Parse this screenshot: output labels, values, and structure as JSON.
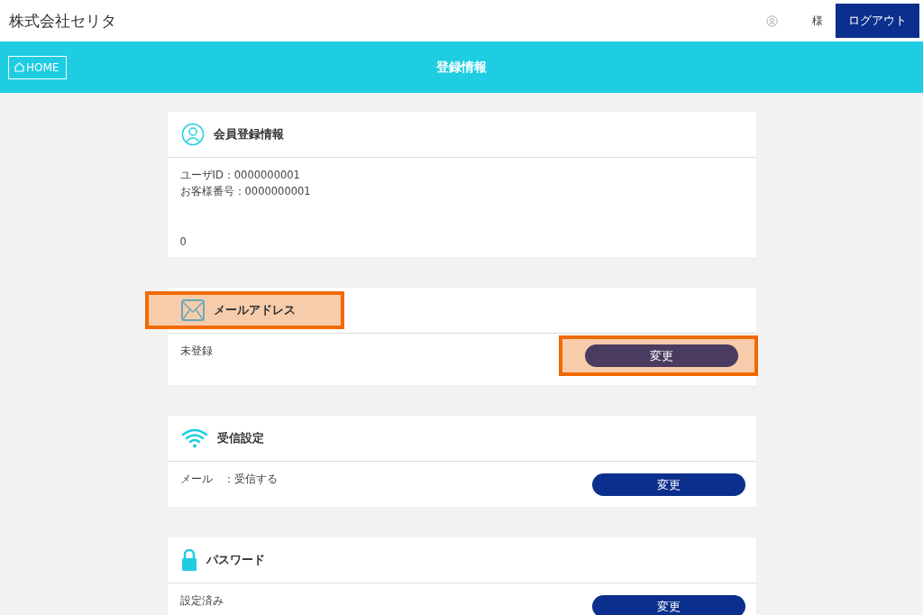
{
  "header": {
    "company": "株式会社セリタ",
    "user_suffix": "様",
    "logout": "ログアウト"
  },
  "nav": {
    "home": "HOME",
    "title": "登録情報"
  },
  "sections": [
    {
      "kind": "user",
      "title": "会員登録情報",
      "highlighted": false,
      "lines": [
        "ユーザID：0000000001",
        "お客様番号：0000000001"
      ],
      "footer": "0"
    },
    {
      "kind": "mail",
      "title": "メールアドレス",
      "highlighted": true,
      "lines": [
        "未登録"
      ],
      "button": {
        "label": "変更",
        "highlighted": true
      }
    },
    {
      "kind": "wifi",
      "title": "受信設定",
      "highlighted": false,
      "lines": [
        "メール　：受信する"
      ],
      "button": {
        "label": "変更",
        "highlighted": false
      }
    },
    {
      "kind": "lock",
      "title": "パスワード",
      "highlighted": false,
      "lines": [
        "設定済み"
      ],
      "button": {
        "label": "変更",
        "highlighted": false
      }
    }
  ]
}
